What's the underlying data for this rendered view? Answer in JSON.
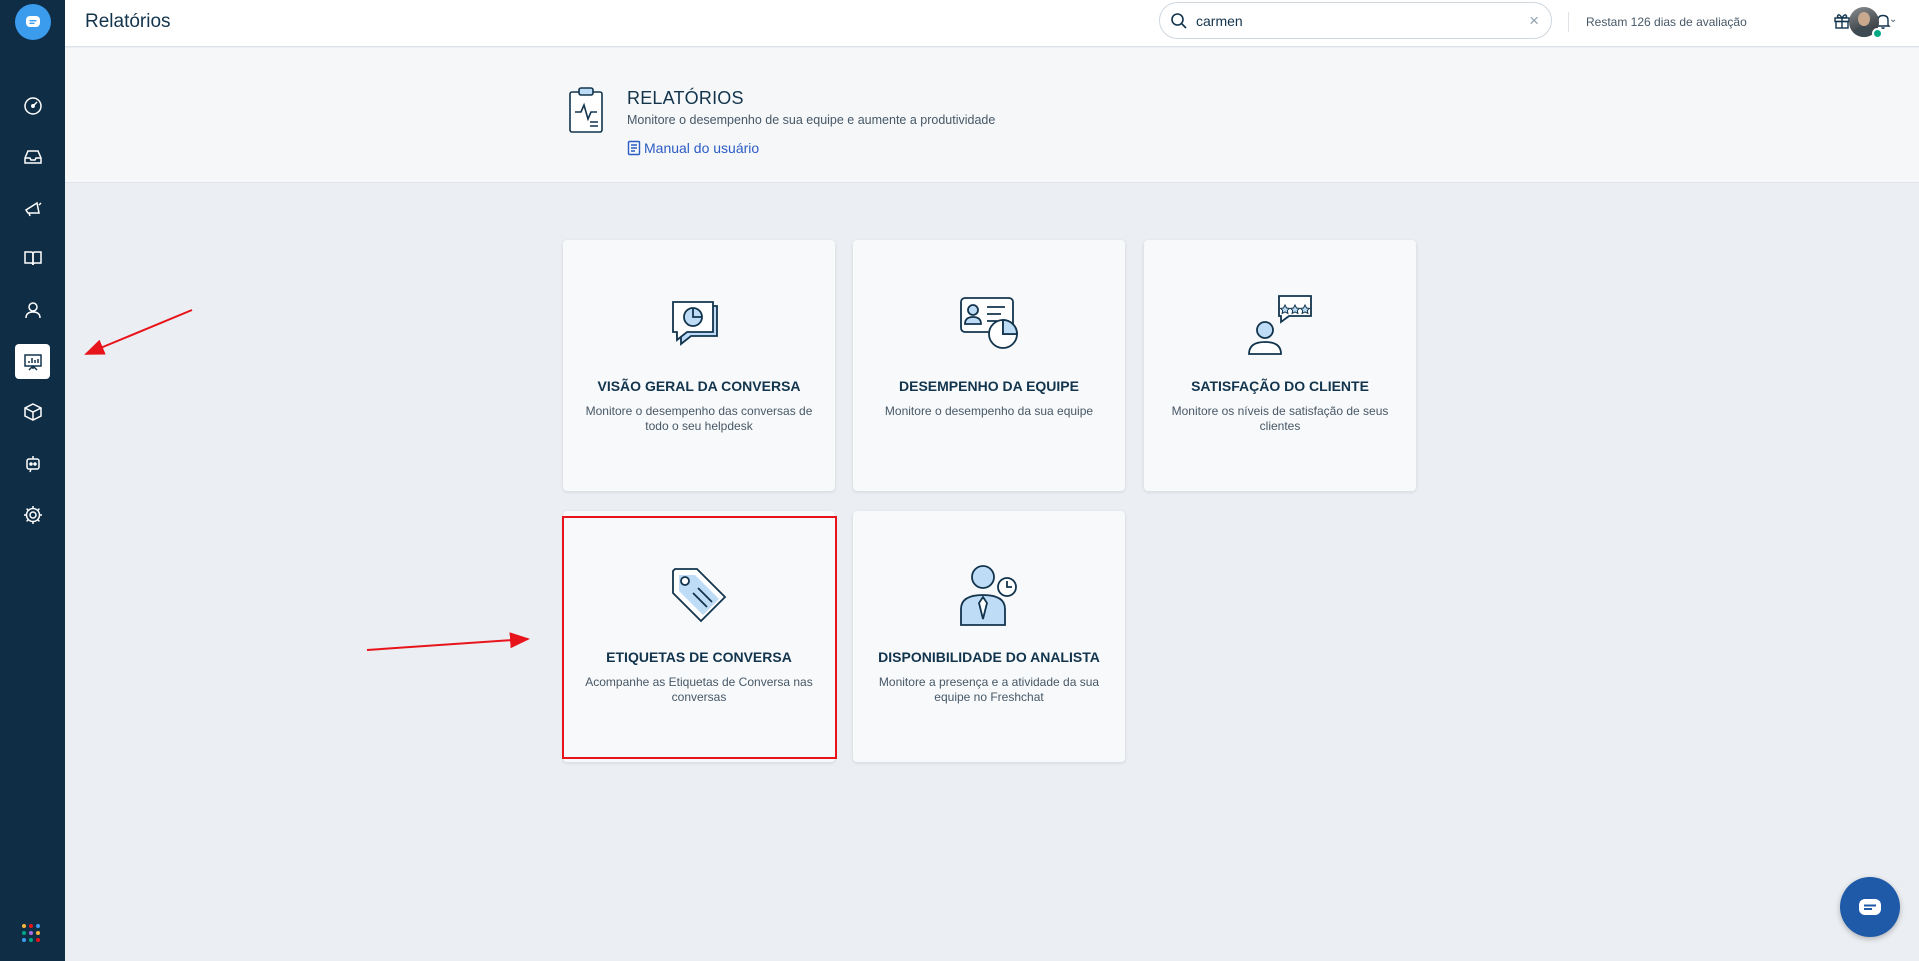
{
  "header": {
    "title": "Relatórios",
    "search_value": "carmen",
    "clear_symbol": "×",
    "trial_text": "Restam 126 dias de avaliação",
    "caret": "⌄"
  },
  "hero": {
    "title": "RELATÓRIOS",
    "subtitle": "Monitore o desempenho de sua equipe e aumente a produtividade",
    "manual_link": "Manual do usuário"
  },
  "cards": [
    {
      "title": "VISÃO GERAL DA CONVERSA",
      "description": "Monitore o desempenho das conversas de todo o seu helpdesk",
      "icon": "conversation-chart-icon"
    },
    {
      "title": "DESEMPENHO DA EQUIPE",
      "description": "Monitore o desempenho da sua equipe",
      "icon": "team-performance-icon"
    },
    {
      "title": "SATISFAÇÃO DO CLIENTE",
      "description": "Monitore os níveis de satisfação de seus clientes",
      "icon": "customer-rating-icon"
    },
    {
      "title": "ETIQUETAS DE CONVERSA",
      "description": "Acompanhe as Etiquetas de Conversa nas conversas",
      "icon": "tag-icon"
    },
    {
      "title": "DISPONIBILIDADE DO ANALISTA",
      "description": "Monitore a presença e a atividade da sua equipe no Freshchat",
      "icon": "agent-clock-icon"
    }
  ],
  "sidebar": {
    "items": [
      {
        "name": "dashboard",
        "icon": "dashboard-gauge-icon"
      },
      {
        "name": "inbox",
        "icon": "inbox-tray-icon"
      },
      {
        "name": "campaigns",
        "icon": "megaphone-icon"
      },
      {
        "name": "knowledge-base",
        "icon": "book-icon"
      },
      {
        "name": "contacts",
        "icon": "person-icon"
      },
      {
        "name": "reports",
        "icon": "presentation-chart-icon",
        "active": true
      },
      {
        "name": "integrations",
        "icon": "cube-icon"
      },
      {
        "name": "bots",
        "icon": "bot-icon"
      },
      {
        "name": "settings",
        "icon": "gear-icon"
      }
    ]
  },
  "colors": {
    "sidebar_bg": "#0f2d45",
    "accent": "#3b9cee",
    "link": "#2c5cc5",
    "annotation_red": "#e8141b",
    "icon_fill": "#bfdcf6"
  }
}
